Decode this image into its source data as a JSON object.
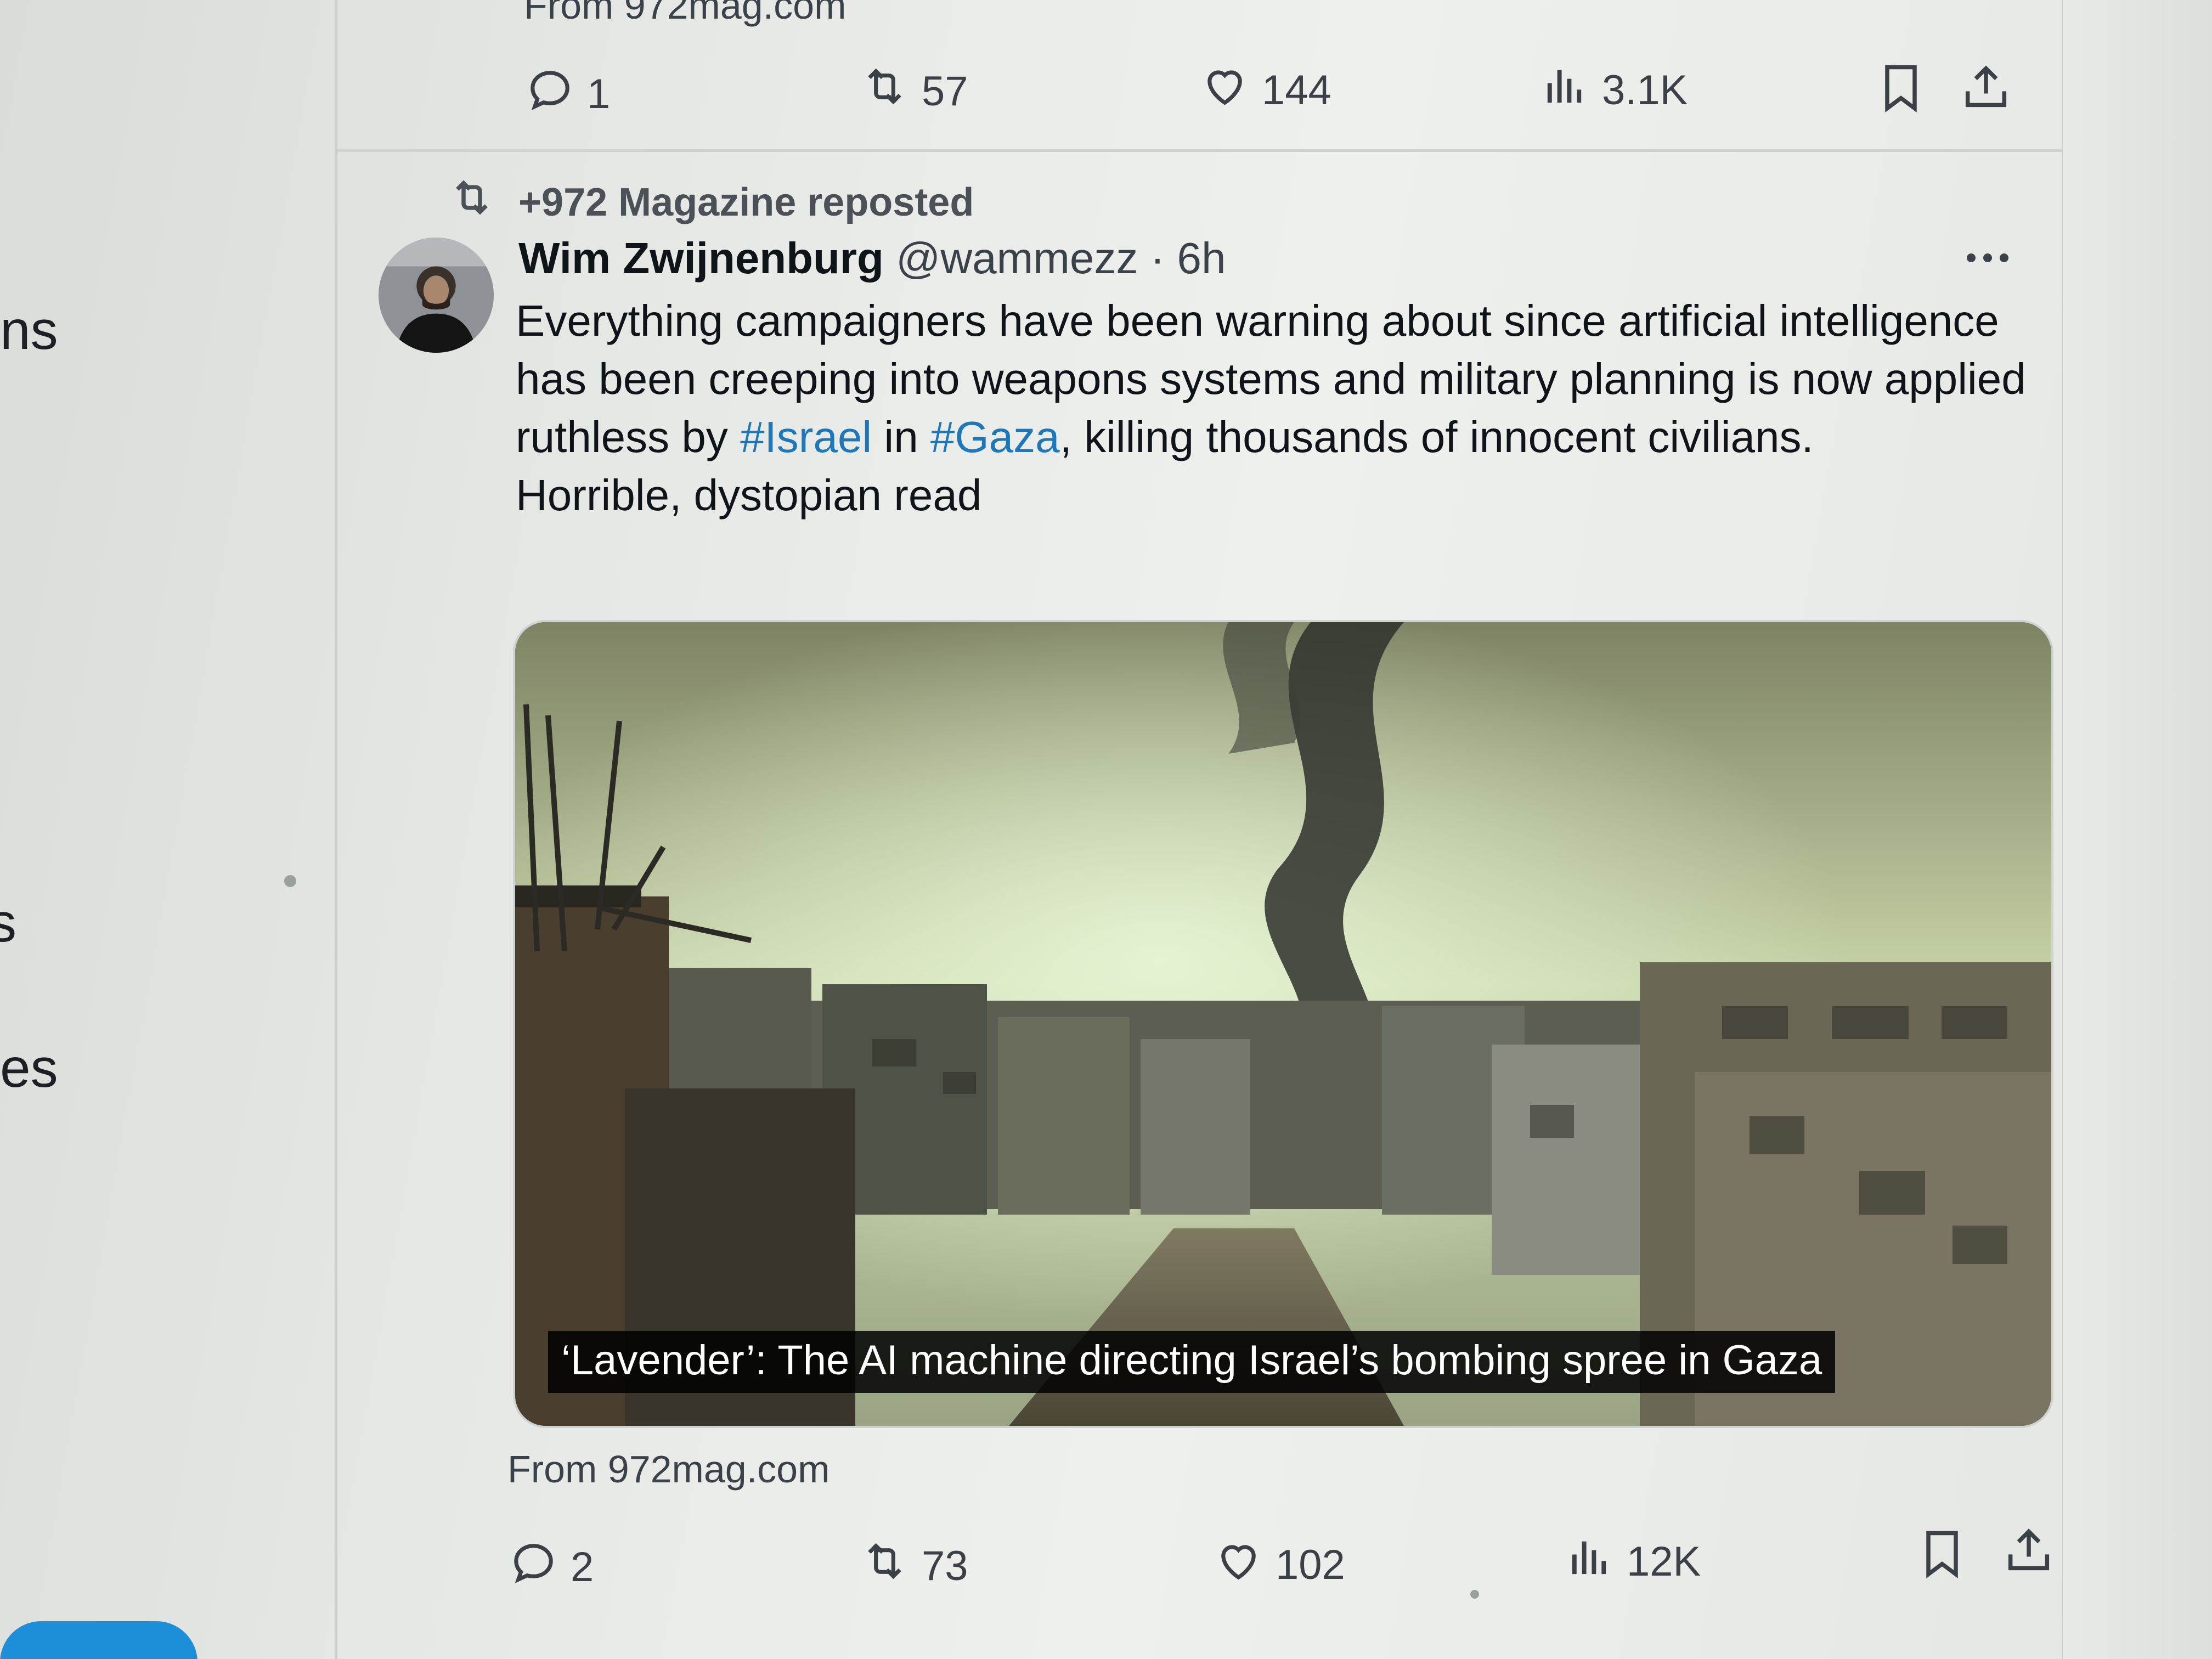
{
  "sidebar": {
    "fragments": [
      "ns",
      "s",
      "es"
    ]
  },
  "top_tweet": {
    "source": "From 972mag.com",
    "actions": {
      "replies": "1",
      "reposts": "57",
      "likes": "144",
      "views": "3.1K"
    }
  },
  "tweet": {
    "repost_label": "+972 Magazine reposted",
    "author_name": "Wim Zwijnenburg",
    "author_handle": "@wammezz",
    "separator": "·",
    "time": "6h",
    "text": {
      "line1": "Everything campaigners have been warning about since artificial intelligence has been creeping into weapons systems and military planning is now applied ruthless by ",
      "hashtag1": "#Israel",
      "mid": " in ",
      "hashtag2": "#Gaza",
      "line_end": ", killing thousands of innocent civilians.",
      "line2": "Horrible, dystopian read"
    },
    "card": {
      "title": "‘Lavender’: The AI machine directing Israel’s bombing spree in Gaza",
      "source": "From 972mag.com"
    },
    "actions": {
      "replies": "2",
      "reposts": "73",
      "likes": "102",
      "views": "12K"
    }
  },
  "colors": {
    "link": "#1d77b8",
    "text": "#0f1419",
    "secondary": "#3b4148",
    "brand_button": "#1d8fd8"
  },
  "icons": [
    "reply-icon",
    "repost-icon",
    "like-icon",
    "views-icon",
    "bookmark-icon",
    "share-icon",
    "more-icon"
  ]
}
